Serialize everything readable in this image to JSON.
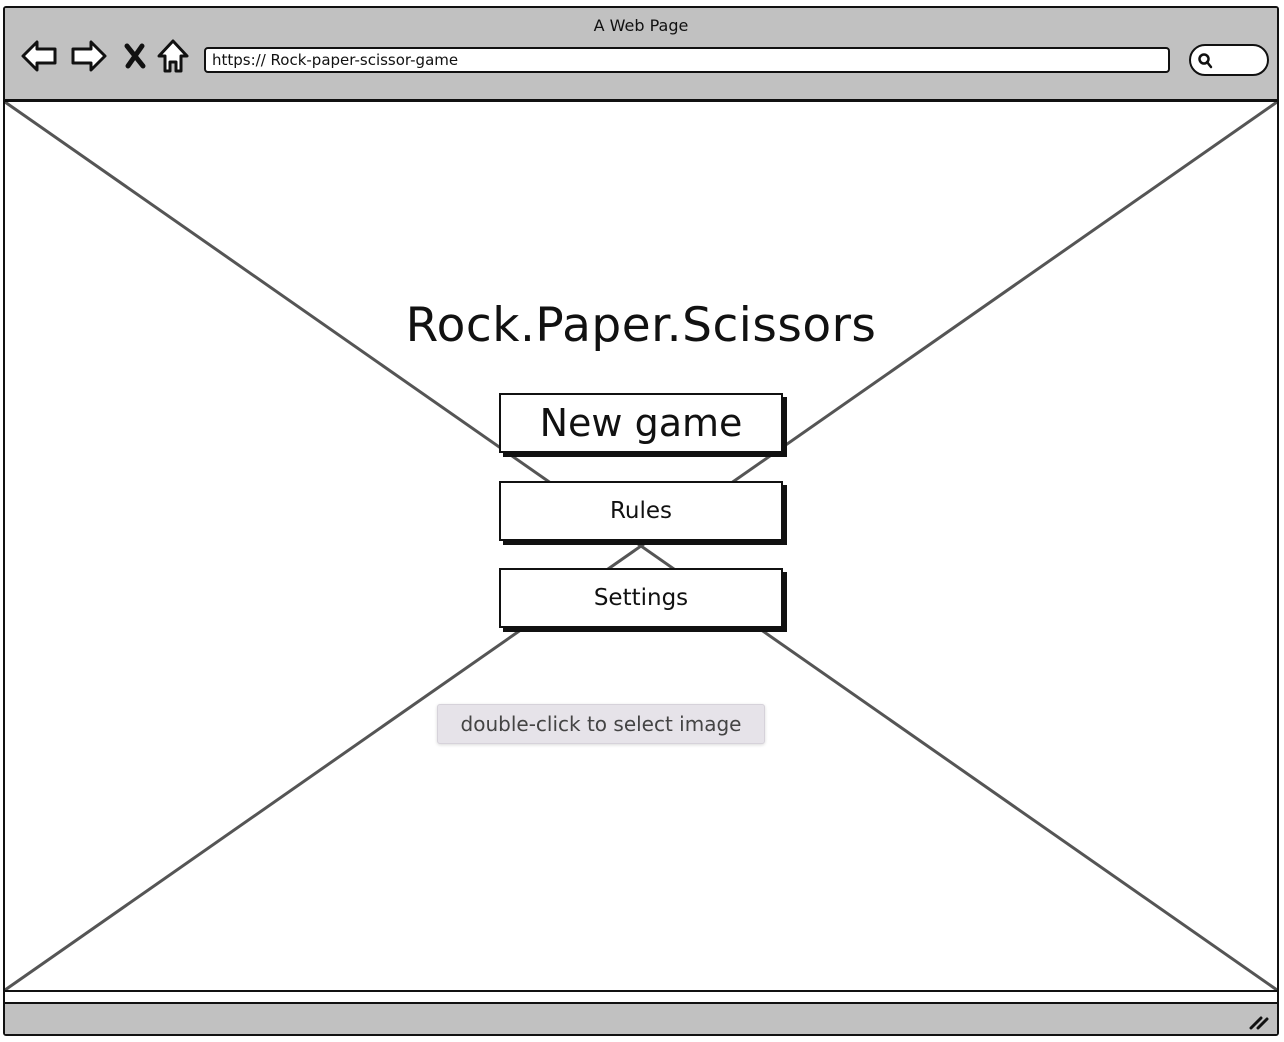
{
  "window": {
    "title": "A Web Page"
  },
  "address_bar": {
    "url": "https:// Rock-paper-scissor-game"
  },
  "nav_icons": [
    "back-arrow-icon",
    "forward-arrow-icon",
    "close-x-icon",
    "home-icon",
    "search-icon"
  ],
  "main": {
    "title": "Rock.Paper.Scissors",
    "buttons": {
      "new_game": "New game",
      "rules": "Rules",
      "settings": "Settings"
    }
  },
  "tooltip": {
    "text": "double-click to select image"
  },
  "colors": {
    "chrome": "#c1c1c1",
    "ink": "#111111",
    "placeholder_lines": "#555555",
    "tooltip_bg": "#e6e3e9"
  }
}
